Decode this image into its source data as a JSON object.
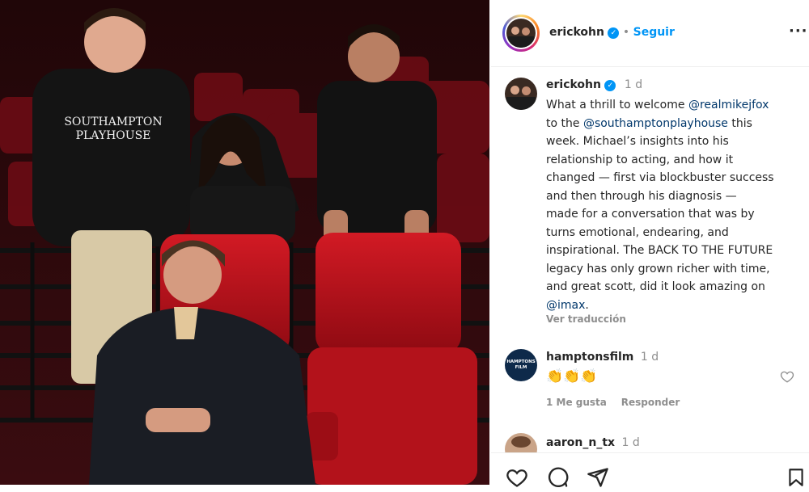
{
  "post": {
    "author": "erickohn",
    "follow_label": "Seguir",
    "dot": "•",
    "more_label": "···"
  },
  "caption": {
    "author": "erickohn",
    "time": "1 d",
    "lines": [
      {
        "pre": "What a thrill to welcome ",
        "link": "@realmikejfox",
        "post": ""
      },
      {
        "pre": "to the ",
        "link": "@southamptonplayhouse",
        "post": " this"
      },
      {
        "pre": "week. Michael’s insights into his",
        "link": "",
        "post": ""
      },
      {
        "pre": "relationship to acting, and how it",
        "link": "",
        "post": ""
      },
      {
        "pre": "changed — first via blockbuster success",
        "link": "",
        "post": ""
      },
      {
        "pre": "and then through his diagnosis —",
        "link": "",
        "post": ""
      },
      {
        "pre": "made for a conversation that was by",
        "link": "",
        "post": ""
      },
      {
        "pre": "turns emotional, endearing, and",
        "link": "",
        "post": ""
      },
      {
        "pre": "inspirational. The BACK TO THE FUTURE",
        "link": "",
        "post": ""
      },
      {
        "pre": "legacy has only grown richer with time,",
        "link": "",
        "post": ""
      },
      {
        "pre": "and great scott, did it look amazing on",
        "link": "",
        "post": ""
      },
      {
        "pre": "",
        "link": "@imax",
        "post": "."
      }
    ],
    "translate_label": "Ver traducción"
  },
  "comments": [
    {
      "author": "hamptonsfilm",
      "time": "1 d",
      "text": "👏👏👏",
      "likes_label": "1 Me gusta",
      "reply_label": "Responder",
      "avatar_text": "HAMPTONS FILM"
    },
    {
      "author": "aaron_n_tx",
      "time": "1 d"
    }
  ],
  "photo": {
    "shirt_text_line1": "SOUTHAMPTON",
    "shirt_text_line2": "PLAYHOUSE"
  },
  "icons": [
    "heart-icon",
    "comment-icon",
    "share-icon",
    "save-icon",
    "verified-badge-icon",
    "more-icon"
  ],
  "colors": {
    "accent_blue": "#0095f6",
    "link_navy": "#00376b",
    "seat_red": "#c8141e",
    "background_dark": "#2a0d10"
  }
}
